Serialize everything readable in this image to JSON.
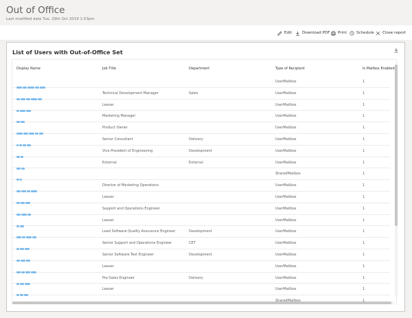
{
  "page": {
    "title": "Out of Office",
    "last_modified": "Last modified date Tue, 29th Oct 2019 1:53pm"
  },
  "toolbar": {
    "edit_label": "Edit",
    "download_pdf_label": "Download PDF",
    "print_label": "Print",
    "schedule_label": "Schedule",
    "close_report_label": "Close report"
  },
  "report": {
    "title": "List of Users with Out-of-Office Set",
    "columns": [
      "Display Name",
      "Job Title",
      "Department",
      "Type of Recipient",
      "Is Mailbox Enabled"
    ],
    "rows": [
      {
        "job_title": "",
        "department": "",
        "recipient_type": "UserMailbox",
        "mailbox_enabled": "1"
      },
      {
        "job_title": "Technical Development Manager",
        "department": "Sales",
        "recipient_type": "UserMailbox",
        "mailbox_enabled": "1"
      },
      {
        "job_title": "Leaver",
        "department": "",
        "recipient_type": "UserMailbox",
        "mailbox_enabled": "1"
      },
      {
        "job_title": "Marketing Manager",
        "department": "",
        "recipient_type": "UserMailbox",
        "mailbox_enabled": "1"
      },
      {
        "job_title": "Product Owner",
        "department": "",
        "recipient_type": "UserMailbox",
        "mailbox_enabled": "1"
      },
      {
        "job_title": "Senior Consultant",
        "department": "Delivery",
        "recipient_type": "UserMailbox",
        "mailbox_enabled": "1"
      },
      {
        "job_title": "Vice President of Engineering",
        "department": "Development",
        "recipient_type": "UserMailbox",
        "mailbox_enabled": "1"
      },
      {
        "job_title": "External",
        "department": "External",
        "recipient_type": "UserMailbox",
        "mailbox_enabled": "1"
      },
      {
        "job_title": "",
        "department": "",
        "recipient_type": "SharedMailbox",
        "mailbox_enabled": "1"
      },
      {
        "job_title": "Director of Marketing Operations",
        "department": "",
        "recipient_type": "UserMailbox",
        "mailbox_enabled": "1"
      },
      {
        "job_title": "Leaver",
        "department": "",
        "recipient_type": "UserMailbox",
        "mailbox_enabled": "1"
      },
      {
        "job_title": "Support and Operations Engineer",
        "department": "",
        "recipient_type": "UserMailbox",
        "mailbox_enabled": "1"
      },
      {
        "job_title": "Leaver",
        "department": "",
        "recipient_type": "UserMailbox",
        "mailbox_enabled": "1"
      },
      {
        "job_title": "Lead Software Quality Assurance Engineer",
        "department": "Development",
        "recipient_type": "UserMailbox",
        "mailbox_enabled": "1"
      },
      {
        "job_title": "Senior Support and Operations Engineer",
        "department": "CET",
        "recipient_type": "UserMailbox",
        "mailbox_enabled": "1"
      },
      {
        "job_title": "Senior Software Test Engineer",
        "department": "Development",
        "recipient_type": "UserMailbox",
        "mailbox_enabled": "1"
      },
      {
        "job_title": "Leaver",
        "department": "",
        "recipient_type": "UserMailbox",
        "mailbox_enabled": "1"
      },
      {
        "job_title": "Pre-Sales Engineer",
        "department": "Delivery",
        "recipient_type": "UserMailbox",
        "mailbox_enabled": "1"
      },
      {
        "job_title": "Leaver",
        "department": "",
        "recipient_type": "UserMailbox",
        "mailbox_enabled": "1"
      },
      {
        "job_title": "",
        "department": "",
        "recipient_type": "SharedMailbox",
        "mailbox_enabled": "1"
      }
    ]
  },
  "icons": {
    "edit": "pencil-icon",
    "download_pdf": "download-icon",
    "print": "printer-icon",
    "schedule": "clock-icon",
    "close_report": "close-icon",
    "export": "download-icon"
  },
  "colors": {
    "name_link": "#1f8ce6",
    "background": "#f3f2f1",
    "card": "#ffffff"
  }
}
